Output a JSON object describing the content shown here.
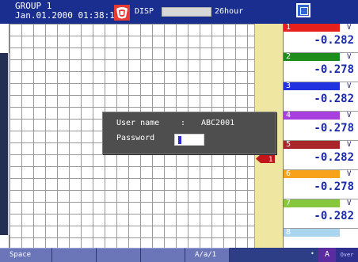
{
  "header": {
    "group": "GROUP 1",
    "datetime": "Jan.01.2000 01:38:15",
    "alarm_icon": "alarm-icon",
    "disp_label": "DISP",
    "rate": "26hour",
    "media_icon": "media-icon"
  },
  "marker": {
    "label": "1",
    "icon": "channel-marker-icon"
  },
  "channels": [
    {
      "num": "1",
      "unit": "V",
      "value": "-0.282",
      "color": "#e8201c"
    },
    {
      "num": "2",
      "unit": "V",
      "value": "-0.278",
      "color": "#1f8d1e"
    },
    {
      "num": "3",
      "unit": "V",
      "value": "-0.282",
      "color": "#2132e0"
    },
    {
      "num": "4",
      "unit": "V",
      "value": "-0.278",
      "color": "#a840e0"
    },
    {
      "num": "5",
      "unit": "V",
      "value": "-0.282",
      "color": "#a8262a"
    },
    {
      "num": "6",
      "unit": "V",
      "value": "-0.278",
      "color": "#f7a21a"
    },
    {
      "num": "7",
      "unit": "V",
      "value": "-0.282",
      "color": "#86c73d"
    },
    {
      "num": "8",
      "unit": "",
      "value": "",
      "color": "#a9d6ee"
    }
  ],
  "dialog": {
    "user_label": "User name",
    "user_separator": ":",
    "user_value": "ABC2001",
    "password_label": "Password",
    "password_value": ""
  },
  "softkeys": [
    {
      "label": "Space"
    },
    {
      "label": ""
    },
    {
      "label": ""
    },
    {
      "label": ""
    },
    {
      "label": "A/a/1"
    }
  ],
  "status": {
    "mode": "A",
    "over": "Over",
    "dot": "•"
  }
}
